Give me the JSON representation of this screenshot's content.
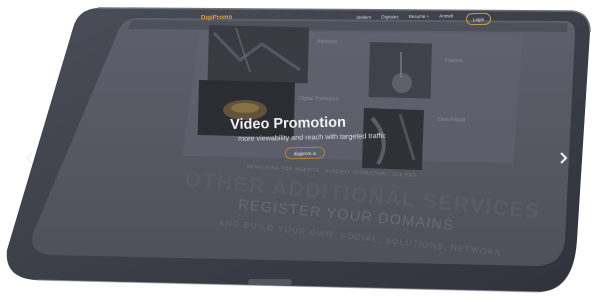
{
  "site": {
    "logo": "DigiPromo",
    "nav": [
      "Stellenr",
      "Digitales",
      "Resume +",
      "Anmelt"
    ],
    "login_label": "Login"
  },
  "hero": {
    "title": "Video Promotion",
    "subtitle": "more viewability and reach with targeted traffic",
    "button_label": "digiprom.io"
  },
  "panels": {
    "label_top_left": "Adwords",
    "label_mid": "Digital Promotion",
    "label_right_top": "Frames",
    "label_right_bottom": "Dein Rabatt"
  },
  "lower": {
    "strip": "SEARCHING FOR WEBSITE · ALREADY PROMOTION · SEE PRO",
    "heading": "OTHER ADDITIONAL SERVICES",
    "subheading": "REGISTER YOUR DOMAINS",
    "tagline": "AND BUILD YOUR OWN, SOCIAL, SOLUTIONS, NETWORK"
  },
  "icons": {
    "prev": "chevron-left-icon",
    "next": "chevron-right-icon"
  },
  "colors": {
    "device_body": "#3d4049",
    "screen": "#545762",
    "accent": "#d29a45"
  }
}
